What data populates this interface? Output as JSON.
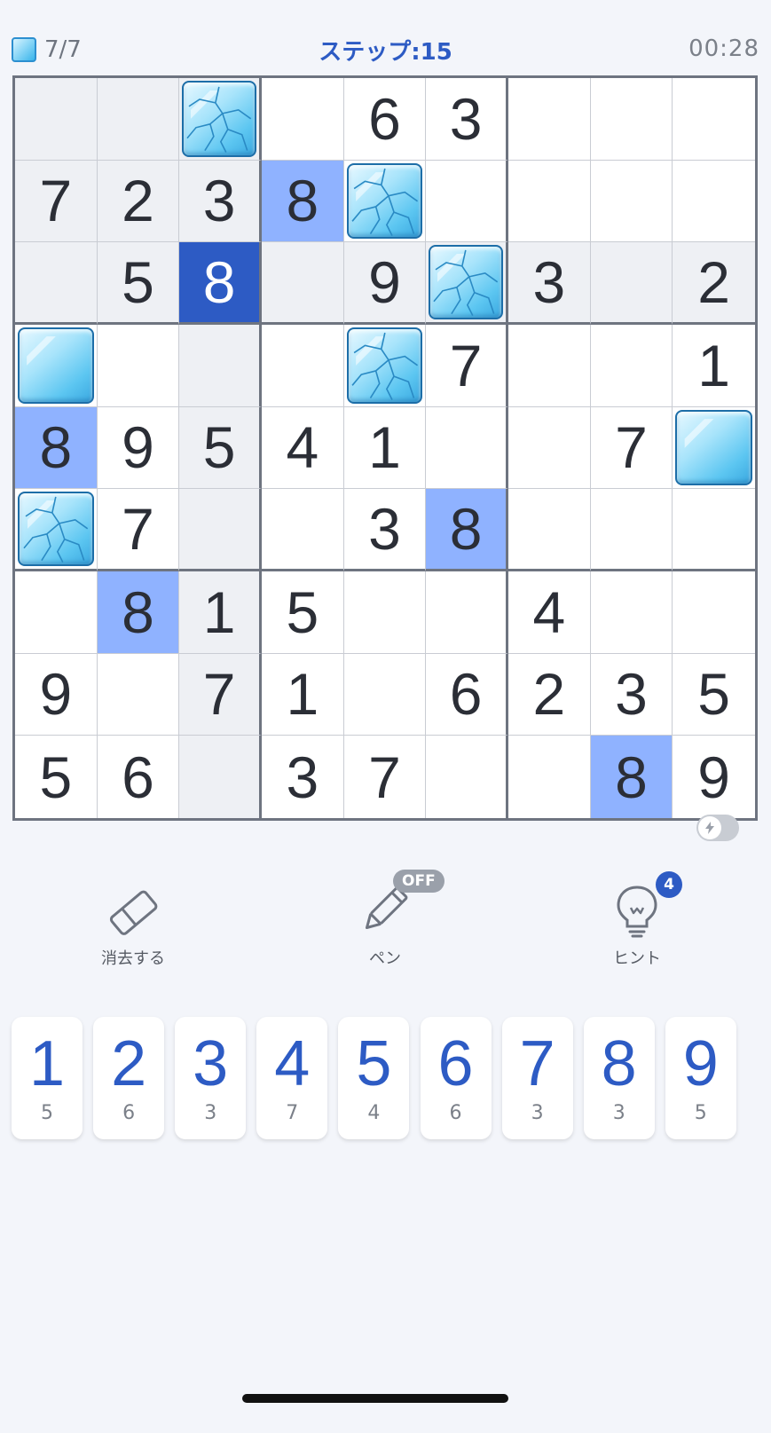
{
  "header": {
    "ice_count": "7/7",
    "steps": "ステップ:15",
    "timer": "00:28"
  },
  "board": {
    "rows": [
      [
        "",
        "",
        "",
        "",
        "6",
        "3",
        "",
        "",
        ""
      ],
      [
        "7",
        "2",
        "3",
        "8",
        "",
        "",
        "",
        "",
        ""
      ],
      [
        "",
        "5",
        "8",
        "",
        "9",
        "",
        "3",
        "",
        "2"
      ],
      [
        "",
        "",
        "",
        "",
        "",
        "7",
        "",
        "",
        "1"
      ],
      [
        "8",
        "9",
        "5",
        "4",
        "1",
        "",
        "",
        "7",
        ""
      ],
      [
        "",
        "7",
        "",
        "",
        "3",
        "8",
        "",
        "",
        ""
      ],
      [
        "",
        "8",
        "1",
        "5",
        "",
        "",
        "4",
        "",
        ""
      ],
      [
        "9",
        "",
        "7",
        "1",
        "",
        "6",
        "2",
        "3",
        "5"
      ],
      [
        "5",
        "6",
        "",
        "3",
        "7",
        "",
        "",
        "8",
        "9"
      ]
    ],
    "ice_cells": [
      {
        "r": 0,
        "c": 2,
        "cracked": true
      },
      {
        "r": 1,
        "c": 4,
        "cracked": true
      },
      {
        "r": 2,
        "c": 5,
        "cracked": true
      },
      {
        "r": 3,
        "c": 0,
        "cracked": false
      },
      {
        "r": 3,
        "c": 4,
        "cracked": true
      },
      {
        "r": 4,
        "c": 8,
        "cracked": false
      },
      {
        "r": 5,
        "c": 0,
        "cracked": true
      }
    ],
    "selected": {
      "r": 2,
      "c": 2
    },
    "colors": {
      "selected": "#2d5bc4",
      "same_number": "#8fb2ff",
      "related": "#eef0f4"
    }
  },
  "tools": {
    "erase": {
      "label": "消去する",
      "icon": "eraser-icon"
    },
    "pen": {
      "label": "ペン",
      "icon": "pencil-icon",
      "state": "OFF"
    },
    "hint": {
      "label": "ヒント",
      "icon": "lightbulb-icon",
      "count": "4"
    }
  },
  "numpad": [
    {
      "digit": "1",
      "remaining": "5"
    },
    {
      "digit": "2",
      "remaining": "6"
    },
    {
      "digit": "3",
      "remaining": "3"
    },
    {
      "digit": "4",
      "remaining": "7"
    },
    {
      "digit": "5",
      "remaining": "4"
    },
    {
      "digit": "6",
      "remaining": "6"
    },
    {
      "digit": "7",
      "remaining": "3"
    },
    {
      "digit": "8",
      "remaining": "3"
    },
    {
      "digit": "9",
      "remaining": "5"
    }
  ]
}
